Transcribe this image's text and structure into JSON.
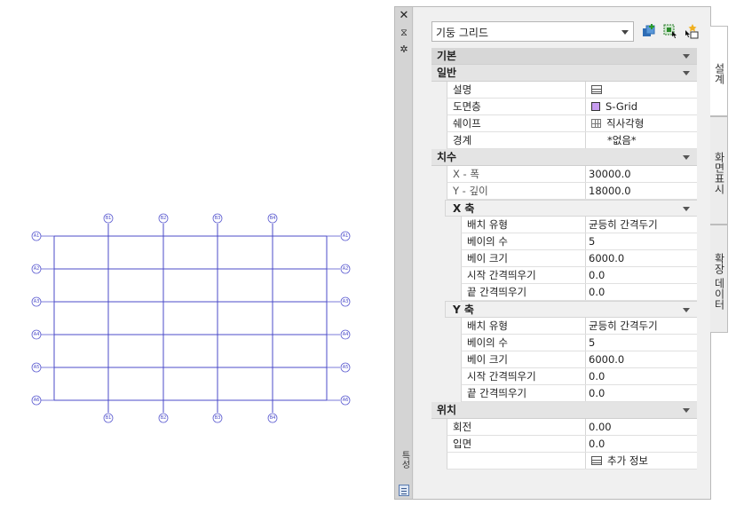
{
  "drawing": {
    "x_bubbles_top": [
      "B1",
      "B2",
      "B3",
      "B4"
    ],
    "x_bubbles_bottom": [
      "B1",
      "B2",
      "B3",
      "B4"
    ],
    "y_bubbles_left": [
      "A1",
      "A2",
      "A3",
      "A4",
      "A5",
      "A6"
    ],
    "y_bubbles_right": [
      "A1",
      "A2",
      "A3",
      "A4",
      "A5",
      "A6"
    ]
  },
  "palette": {
    "close_icon": "close-icon",
    "pin_icon": "autohide-icon",
    "settings_icon": "settings-icon",
    "vertical_label": "특성",
    "style_select_value": "기둥 그리드",
    "colors": {
      "grid": "#4b4bc8",
      "layer_swatch": "#c79cf0"
    }
  },
  "sections": {
    "basic": "기본",
    "general": "일반",
    "dimensions": "치수",
    "x_axis": "X 축",
    "y_axis": "Y 축",
    "location": "위치"
  },
  "general": [
    {
      "name": "설명",
      "value": ""
    },
    {
      "name": "도면층",
      "value": "S-Grid"
    },
    {
      "name": "쉐이프",
      "value": "직사각형"
    },
    {
      "name": "경계",
      "value": "*없음*"
    }
  ],
  "dimensions": [
    {
      "name": "X - 폭",
      "value": "30000.0"
    },
    {
      "name": "Y - 깊이",
      "value": "18000.0"
    }
  ],
  "x_axis": [
    {
      "name": "배치 유형",
      "value": "균등히 간격두기"
    },
    {
      "name": "베이의 수",
      "value": "5"
    },
    {
      "name": "베이 크기",
      "value": "6000.0"
    },
    {
      "name": "시작 간격띄우기",
      "value": "0.0"
    },
    {
      "name": "끝 간격띄우기",
      "value": "0.0"
    }
  ],
  "y_axis": [
    {
      "name": "배치 유형",
      "value": "균등히 간격두기"
    },
    {
      "name": "베이의 수",
      "value": "5"
    },
    {
      "name": "베이 크기",
      "value": "6000.0"
    },
    {
      "name": "시작 간격띄우기",
      "value": "0.0"
    },
    {
      "name": "끝 간격띄우기",
      "value": "0.0"
    }
  ],
  "location": [
    {
      "name": "회전",
      "value": "0.00"
    },
    {
      "name": "입면",
      "value": "0.0"
    },
    {
      "name": "",
      "value": "추가 정보"
    }
  ],
  "tabs": [
    "설계",
    "화면표시",
    "확장 데이터"
  ]
}
